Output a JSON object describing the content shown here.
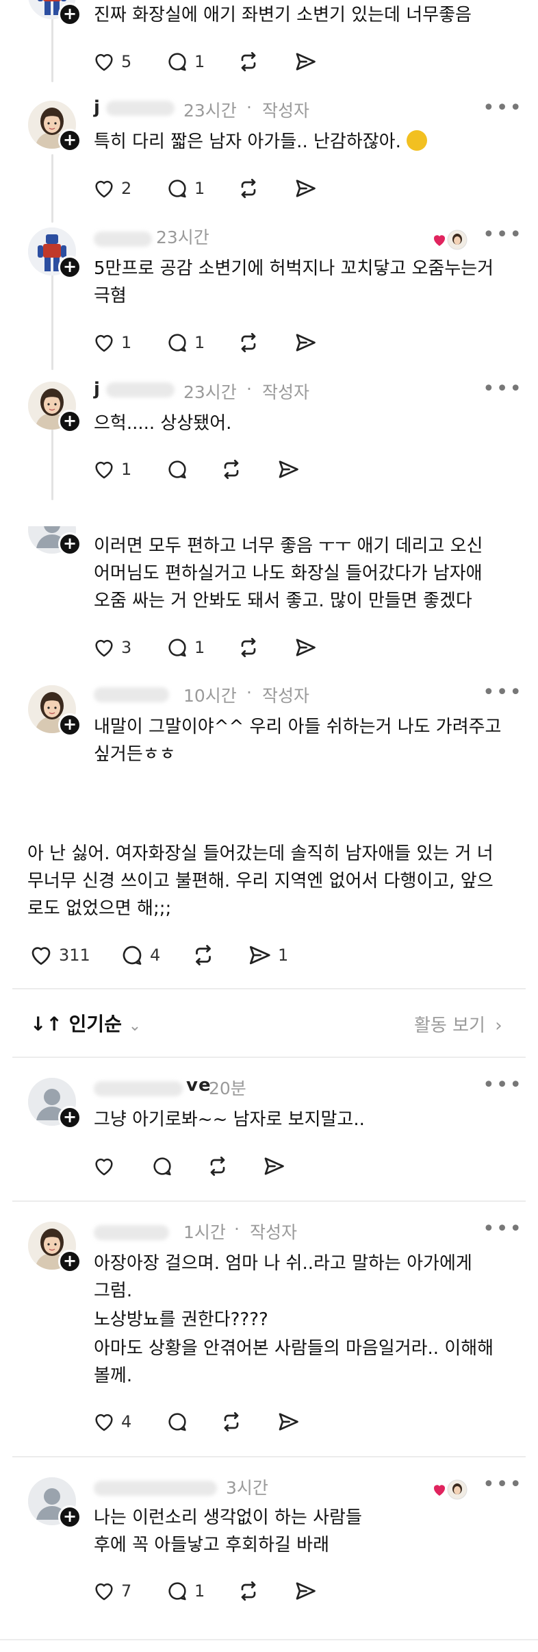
{
  "comments": [
    {
      "author": "",
      "time": "",
      "author_tag": "",
      "text": "진짜 화장실에 애기 좌변기 소변기 있는데 너무좋음",
      "likes": "5",
      "replies": "1"
    },
    {
      "author": "j",
      "time": "23시간",
      "author_tag": "작성자",
      "text": "특히 다리 짧은 남자 아가들.. 난감하잖아.",
      "likes": "2",
      "replies": "1"
    },
    {
      "author": "",
      "time": "23시간",
      "author_tag": "",
      "text_line1": "5만프로 공감 소변기에 허벅지나 꼬치닿고 오줌누는거",
      "text_line2": "극혐",
      "likes": "1",
      "replies": "1"
    },
    {
      "author": "j",
      "time": "23시간",
      "author_tag": "작성자",
      "text": "으헉..... 상상됐어.",
      "likes": "1",
      "replies": ""
    },
    {
      "author": "",
      "time": "",
      "author_tag": "",
      "text_line1": "이러면 모두 편하고 너무 좋음 ㅜㅜ 애기 데리고 오신",
      "text_line2": "어머님도 편하실거고 나도 화장실 들어갔다가 남자애",
      "text_line3": "오줌 싸는 거 안봐도 돼서 좋고. 많이 만들면 좋겠다",
      "likes": "3",
      "replies": "1"
    },
    {
      "author": "",
      "time": "10시간",
      "author_tag": "작성자",
      "text_line1": "내말이 그말이야^^ 우리 아들 쉬하는거 나도 가려주고",
      "text_line2": "싶거든ㅎㅎ",
      "likes": "",
      "replies": ""
    }
  ],
  "main_post": {
    "line1": "아 난 싫어. 여자화장실 들어갔는데 솔직히 남자애들 있는 거 너",
    "line2": "무너무 신경 쓰이고 불편해. 우리 지역엔 없어서 다행이고, 앞으",
    "line3": "로도 없었으면 해;;;",
    "likes": "311",
    "replies": "4",
    "shares": "1"
  },
  "sort": {
    "label": "인기순",
    "activity_label": "활동 보기"
  },
  "replies2": [
    {
      "author": "ve",
      "time": "20분",
      "text": "그냥 아기로봐~~ 남자로 보지말고.."
    },
    {
      "author": "",
      "time": "1시간",
      "author_tag": "작성자",
      "text_line1": "아장아장 걸으며. 엄마 나 쉬..라고 말하는 아가에게",
      "text_line2": "그럼.",
      "text_line3": "노상방뇨를 권한다????",
      "text_line4": "아마도 상황을 안겪어본 사람들의 마음일거라.. 이해해",
      "text_line5": "볼께.",
      "likes": "4"
    },
    {
      "author": "",
      "time": "3시간",
      "text_line1": "나는 이런소리 생각없이 하는 사람들",
      "text_line2": "후에 꼭 아들낳고 후회하길 바래",
      "likes": "7",
      "replies": "1"
    }
  ],
  "icons": {
    "like": "heart-icon",
    "reply": "comment-icon",
    "repost": "repost-icon",
    "share": "send-icon",
    "more": "more-icon",
    "sort": "sort-icon",
    "chevron": "chevron-down-icon"
  },
  "colors": {
    "liked_heart": "#e0245e",
    "text": "#111111",
    "muted": "#9a9a9a"
  }
}
